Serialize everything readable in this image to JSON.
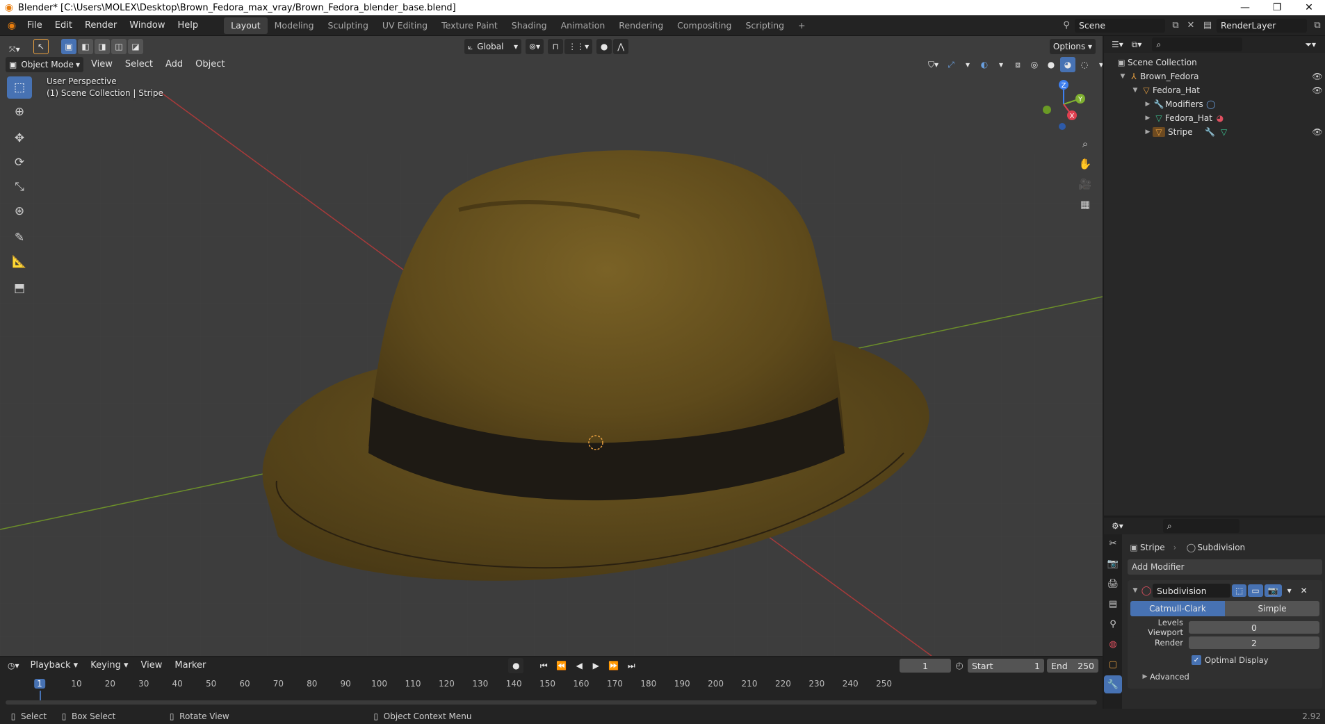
{
  "window": {
    "title": "Blender* [C:\\Users\\MOLEX\\Desktop\\Brown_Fedora_max_vray/Brown_Fedora_blender_base.blend]",
    "minimize": "—",
    "maximize": "❐",
    "close": "✕"
  },
  "menus": [
    "File",
    "Edit",
    "Render",
    "Window",
    "Help"
  ],
  "workspaces": [
    {
      "label": "Layout",
      "active": true
    },
    {
      "label": "Modeling"
    },
    {
      "label": "Sculpting"
    },
    {
      "label": "UV Editing"
    },
    {
      "label": "Texture Paint"
    },
    {
      "label": "Shading"
    },
    {
      "label": "Animation"
    },
    {
      "label": "Rendering"
    },
    {
      "label": "Compositing"
    },
    {
      "label": "Scripting"
    }
  ],
  "add_workspace": "+",
  "scene": {
    "name": "Scene",
    "render_layer": "RenderLayer"
  },
  "header": {
    "mode": "Object Mode",
    "menus": [
      "View",
      "Select",
      "Add",
      "Object"
    ],
    "orientation": "Global",
    "options": "Options"
  },
  "viewport": {
    "perspective": "User Perspective",
    "collection": "(1) Scene Collection | Stripe",
    "gizmo": {
      "z": "Z",
      "y": "Y",
      "x": "X"
    },
    "colors": {
      "grid_bg": "#3d3d3d",
      "x_axis": "#a83a3a",
      "y_axis": "#6c8f2a",
      "hat": "#6b5420",
      "band": "#1e1a14"
    }
  },
  "outliner": {
    "rows": [
      {
        "label": "Scene Collection"
      },
      {
        "label": "Brown_Fedora"
      },
      {
        "label": "Fedora_Hat"
      },
      {
        "label": "Modifiers"
      },
      {
        "label": "Fedora_Hat"
      },
      {
        "label": "Stripe"
      }
    ]
  },
  "properties": {
    "object": "Stripe",
    "modifier_name": "Subdivision",
    "add_modifier": "Add Modifier",
    "panel_name": "Subdivision",
    "type_catmull": "Catmull-Clark",
    "type_simple": "Simple",
    "levels_viewport_label": "Levels Viewport",
    "levels_viewport": "0",
    "render_label": "Render",
    "render": "2",
    "optimal_display": "Optimal Display",
    "advanced": "Advanced"
  },
  "timeline": {
    "menus": [
      "Playback",
      "Keying",
      "View",
      "Marker"
    ],
    "current_frame": "1",
    "start_label": "Start",
    "start": "1",
    "end_label": "End",
    "end": "250",
    "ticks": [
      "1",
      "10",
      "20",
      "30",
      "40",
      "50",
      "60",
      "70",
      "80",
      "90",
      "100",
      "110",
      "120",
      "130",
      "140",
      "150",
      "160",
      "170",
      "180",
      "190",
      "200",
      "210",
      "220",
      "230",
      "240",
      "250"
    ]
  },
  "statusbar": {
    "select": "Select",
    "box_select": "Box Select",
    "rotate_view": "Rotate View",
    "context_menu": "Object Context Menu",
    "version": "2.92"
  }
}
